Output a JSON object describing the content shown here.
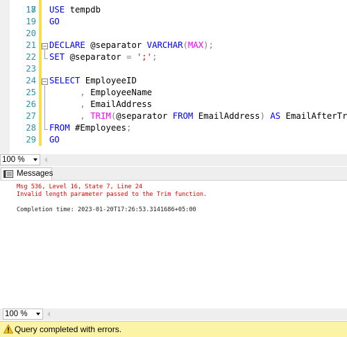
{
  "editor": {
    "partial_line_number": "17",
    "lines": [
      {
        "num": "18",
        "parts": [
          [
            "kw",
            "USE"
          ],
          [
            "pl",
            " tempdb"
          ]
        ]
      },
      {
        "num": "19",
        "parts": [
          [
            "kw",
            "GO"
          ]
        ]
      },
      {
        "num": "20",
        "parts": []
      },
      {
        "num": "21",
        "parts": [
          [
            "kw",
            "DECLARE"
          ],
          [
            "pl",
            " @separator "
          ],
          [
            "kw",
            "VARCHAR"
          ],
          [
            "gr",
            "("
          ],
          [
            "fn",
            "MAX"
          ],
          [
            "gr",
            ");"
          ]
        ]
      },
      {
        "num": "22",
        "parts": [
          [
            "kw",
            "SET"
          ],
          [
            "pl",
            " @separator "
          ],
          [
            "gr",
            "="
          ],
          [
            "pl",
            " "
          ],
          [
            "str",
            "';'"
          ],
          [
            "gr",
            ";"
          ]
        ]
      },
      {
        "num": "23",
        "parts": []
      },
      {
        "num": "24",
        "parts": [
          [
            "kw",
            "SELECT"
          ],
          [
            "pl",
            " EmployeeID"
          ]
        ]
      },
      {
        "num": "25",
        "parts": [
          [
            "pl",
            "      "
          ],
          [
            "gr",
            ","
          ],
          [
            "pl",
            " EmployeeName"
          ]
        ]
      },
      {
        "num": "26",
        "parts": [
          [
            "pl",
            "      "
          ],
          [
            "gr",
            ","
          ],
          [
            "pl",
            " EmailAddress"
          ]
        ]
      },
      {
        "num": "27",
        "parts": [
          [
            "pl",
            "      "
          ],
          [
            "gr",
            ","
          ],
          [
            "pl",
            " "
          ],
          [
            "fn",
            "TRIM"
          ],
          [
            "gr",
            "("
          ],
          [
            "pl",
            "@separator "
          ],
          [
            "kw",
            "FROM"
          ],
          [
            "pl",
            " EmailAddress"
          ],
          [
            "gr",
            ")"
          ],
          [
            "pl",
            " "
          ],
          [
            "kw",
            "AS"
          ],
          [
            "pl",
            " EmailAfterTrim"
          ]
        ]
      },
      {
        "num": "28",
        "parts": [
          [
            "kw",
            "FROM"
          ],
          [
            "pl",
            " #Employees"
          ],
          [
            "gr",
            ";"
          ]
        ]
      },
      {
        "num": "29",
        "parts": [
          [
            "kw",
            "GO"
          ]
        ]
      }
    ]
  },
  "zoom_top": "100 %",
  "zoom_bottom": "100 %",
  "results": {
    "tab_label": "Messages",
    "lines": [
      {
        "text": "Msg 536, Level 16, State 7, Line 24",
        "kind": "err"
      },
      {
        "text": "Invalid length parameter passed to the Trim function.",
        "kind": "err"
      },
      {
        "text": "",
        "kind": "ok"
      },
      {
        "text": "Completion time: 2023-01-20T17:26:53.3141686+05:00",
        "kind": "ok"
      }
    ]
  },
  "status": {
    "text": "Query completed with errors.",
    "bg_color": "#fbf3a6",
    "icon": "warning-icon"
  },
  "colors": {
    "keyword": "#0000ff",
    "string": "#ff0000",
    "function": "#ff00ff",
    "line_number": "#2b91af",
    "error": "#e00000"
  }
}
